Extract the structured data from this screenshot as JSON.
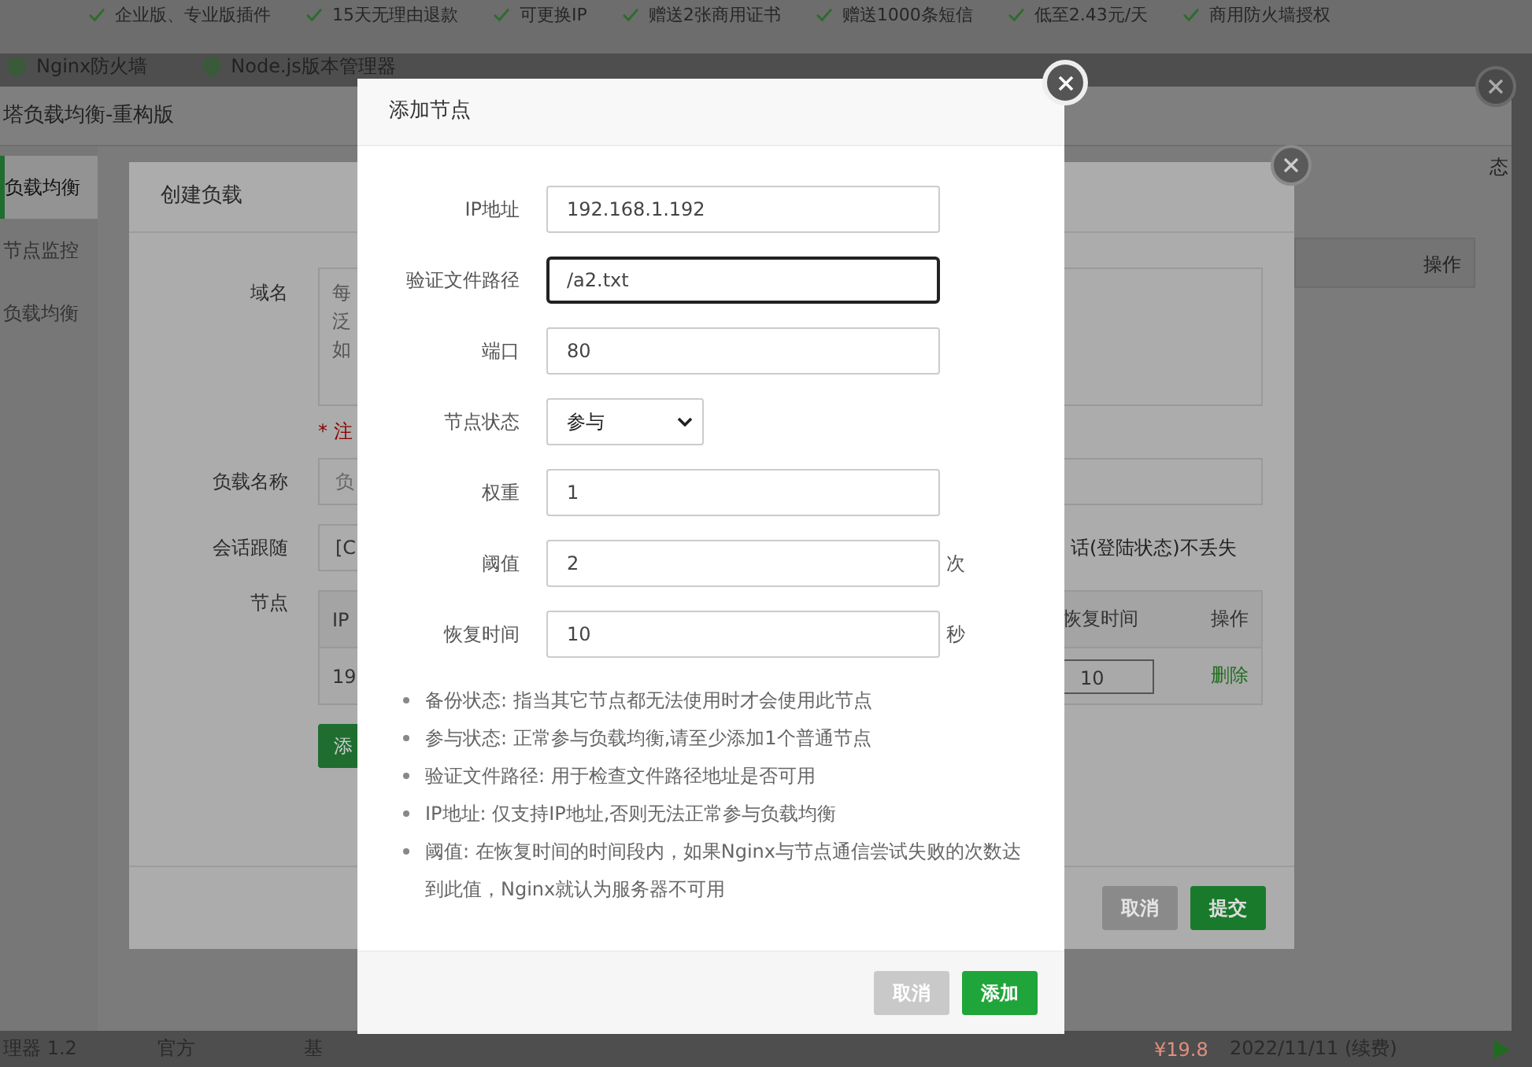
{
  "page": {
    "benefits": [
      "企业版、专业版插件",
      "15天无理由退款",
      "可更换IP",
      "赠送2张商用证书",
      "赠送1000条短信",
      "低至2.43元/天",
      "商用防火墙授权"
    ],
    "plugins": [
      "Nginx防火墙",
      "Node.js版本管理器"
    ],
    "bottom_row": {
      "name": "理器 1.2",
      "source": "官方",
      "description": "基",
      "price": "¥19.8",
      "expiry": "2022/11/11 (续费)"
    }
  },
  "plugin_window": {
    "title": "塔负载均衡-重构版",
    "sidebar": [
      {
        "label": "负载均衡",
        "selected": true
      },
      {
        "label": "节点监控",
        "selected": false
      },
      {
        "label": "负载均衡",
        "selected": false
      }
    ],
    "column_3": "态",
    "action_header": "操作"
  },
  "create_dialog": {
    "title": "创建负载",
    "domain_label": "域名",
    "domain_lines": [
      "每",
      "泛",
      "如"
    ],
    "note": "* 注",
    "name_label": "负载名称",
    "name_placeholder": "负",
    "session_label": "会话跟随",
    "session_value": "[C",
    "session_hint": "话(登陆状态)不丢失",
    "nodes_label": "节点",
    "node_columns": [
      "IP",
      "恢复时间",
      "操作"
    ],
    "node_rows": [
      {
        "ip": "19",
        "recover": "10",
        "action": "删除"
      }
    ],
    "add_button": "添",
    "buttons": [
      {
        "label": "取消",
        "kind": "cancel"
      },
      {
        "label": "提交",
        "kind": "primary"
      }
    ]
  },
  "add_node_dialog": {
    "title": "添加节点",
    "fields": [
      {
        "label": "IP地址",
        "kind": "input",
        "value": "192.168.1.192",
        "focused": false
      },
      {
        "label": "验证文件路径",
        "kind": "input",
        "value": "/a2.txt",
        "focused": true
      },
      {
        "label": "端口",
        "kind": "input",
        "value": "80",
        "focused": false
      },
      {
        "label": "节点状态",
        "kind": "select",
        "value": "参与",
        "focused": false
      },
      {
        "label": "权重",
        "kind": "input",
        "value": "1",
        "focused": false
      },
      {
        "label": "阈值",
        "kind": "input",
        "value": "2",
        "unit": "次",
        "focused": false
      },
      {
        "label": "恢复时间",
        "kind": "input",
        "value": "10",
        "unit": "秒",
        "focused": false
      }
    ],
    "notes": [
      "备份状态: 指当其它节点都无法使用时才会使用此节点",
      "参与状态: 正常参与负载均衡,请至少添加1个普通节点",
      "验证文件路径: 用于检查文件路径地址是否可用",
      "IP地址: 仅支持IP地址,否则无法正常参与负载均衡",
      "阈值: 在恢复时间的时间段内，如果Nginx与节点通信尝试失败的次数达到此值，Nginx就认为服务器不可用"
    ],
    "buttons": [
      {
        "label": "取消",
        "kind": "cancel"
      },
      {
        "label": "添加",
        "kind": "primary"
      }
    ]
  }
}
